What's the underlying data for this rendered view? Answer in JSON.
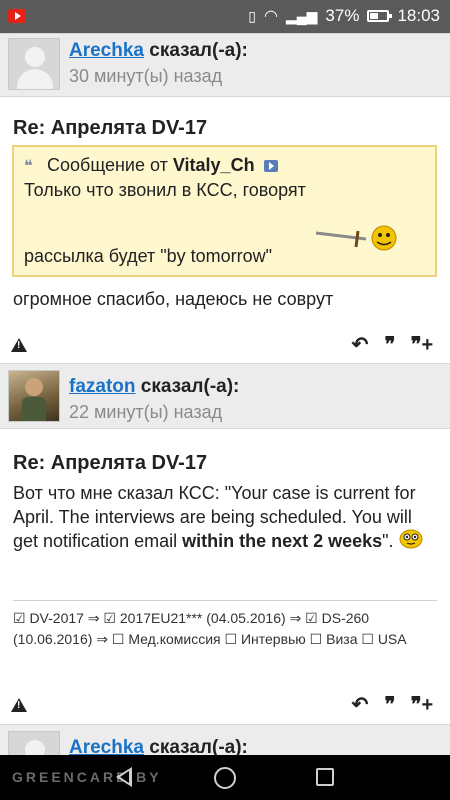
{
  "status_bar": {
    "battery_percent": "37%",
    "time": "18:03",
    "icons": [
      "youtube-icon",
      "vibrate-icon",
      "wifi-icon",
      "signal-icon",
      "battery-icon"
    ]
  },
  "posts": [
    {
      "author": "Arechka",
      "said": "сказал(-а):",
      "time_ago": "30 минут(ы) назад",
      "title": "Re: Апрелята DV-17",
      "quote": {
        "prefix": "Сообщение от",
        "author": "Vitaly_Ch",
        "line1": "Только что звонил в КСС, говорят",
        "line2": "рассылка будет \"by tomorrow\""
      },
      "text": "огромное спасибо, надеюсь не соврут"
    },
    {
      "author": "fazaton",
      "said": "сказал(-а):",
      "time_ago": "22 минут(ы) назад",
      "title": "Re: Апрелята DV-17",
      "text_part1": "Вот что мне сказал КСС: \"Your case is current for April. The interviews are being scheduled. You will get notification email ",
      "text_bold": "within the next 2 weeks",
      "text_part2": "\".",
      "signature": "☑ DV-2017 ⇒ ☑ 2017EU21*** (04.05.2016) ⇒ ☑ DS-260 (10.06.2016) ⇒ ☐ Мед.комиссия ☐ Интервью ☐ Виза ☐ USA"
    },
    {
      "author": "Arechka",
      "said": "сказал(-а):"
    }
  ],
  "actions": {
    "report": "▲",
    "reply": "↶",
    "quote": "❞",
    "multiquote": "❞+"
  },
  "nav_bar": {
    "watermark": "GREENCARD.BY"
  }
}
